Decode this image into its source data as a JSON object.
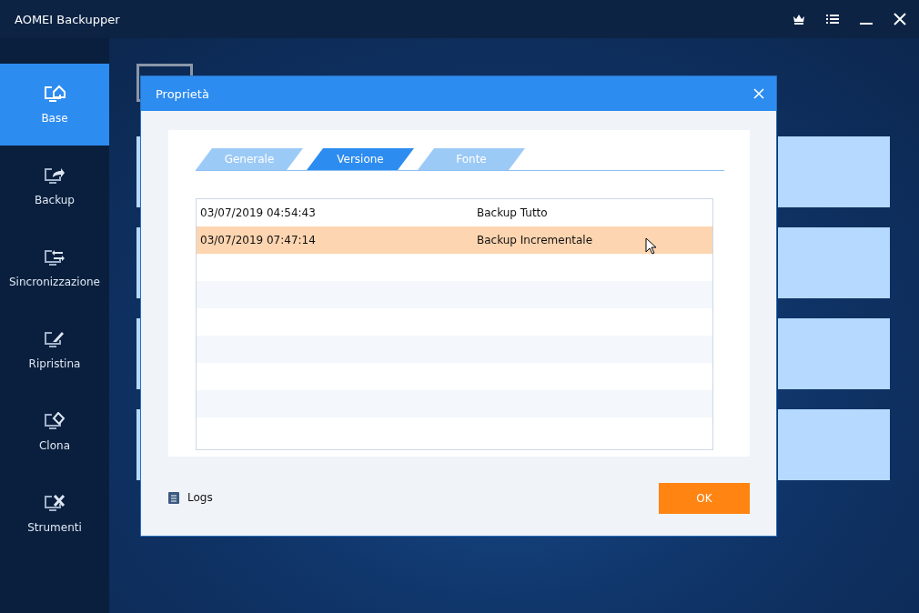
{
  "window": {
    "title": "AOMEI Backupper"
  },
  "sidebar": {
    "items": [
      {
        "label": "Base",
        "kind": "home",
        "selected": true
      },
      {
        "label": "Backup",
        "kind": "share",
        "selected": false
      },
      {
        "label": "Sincronizzazione",
        "kind": "sync",
        "selected": false
      },
      {
        "label": "Ripristina",
        "kind": "restore",
        "selected": false
      },
      {
        "label": "Clona",
        "kind": "clone",
        "selected": false
      },
      {
        "label": "Strumenti",
        "kind": "tools",
        "selected": false
      }
    ]
  },
  "dialog": {
    "title": "Proprietà",
    "tabs": [
      {
        "label": "Generale",
        "selected": false
      },
      {
        "label": "Versione",
        "selected": true
      },
      {
        "label": "Fonte",
        "selected": false
      }
    ],
    "table": {
      "rows": [
        {
          "time": "03/07/2019 04:54:43",
          "type": "Backup Tutto",
          "selected": false
        },
        {
          "time": "03/07/2019 07:47:14",
          "type": "Backup Incrementale",
          "selected": true
        }
      ]
    },
    "logs_link": "Logs",
    "ok_button": "OK"
  }
}
